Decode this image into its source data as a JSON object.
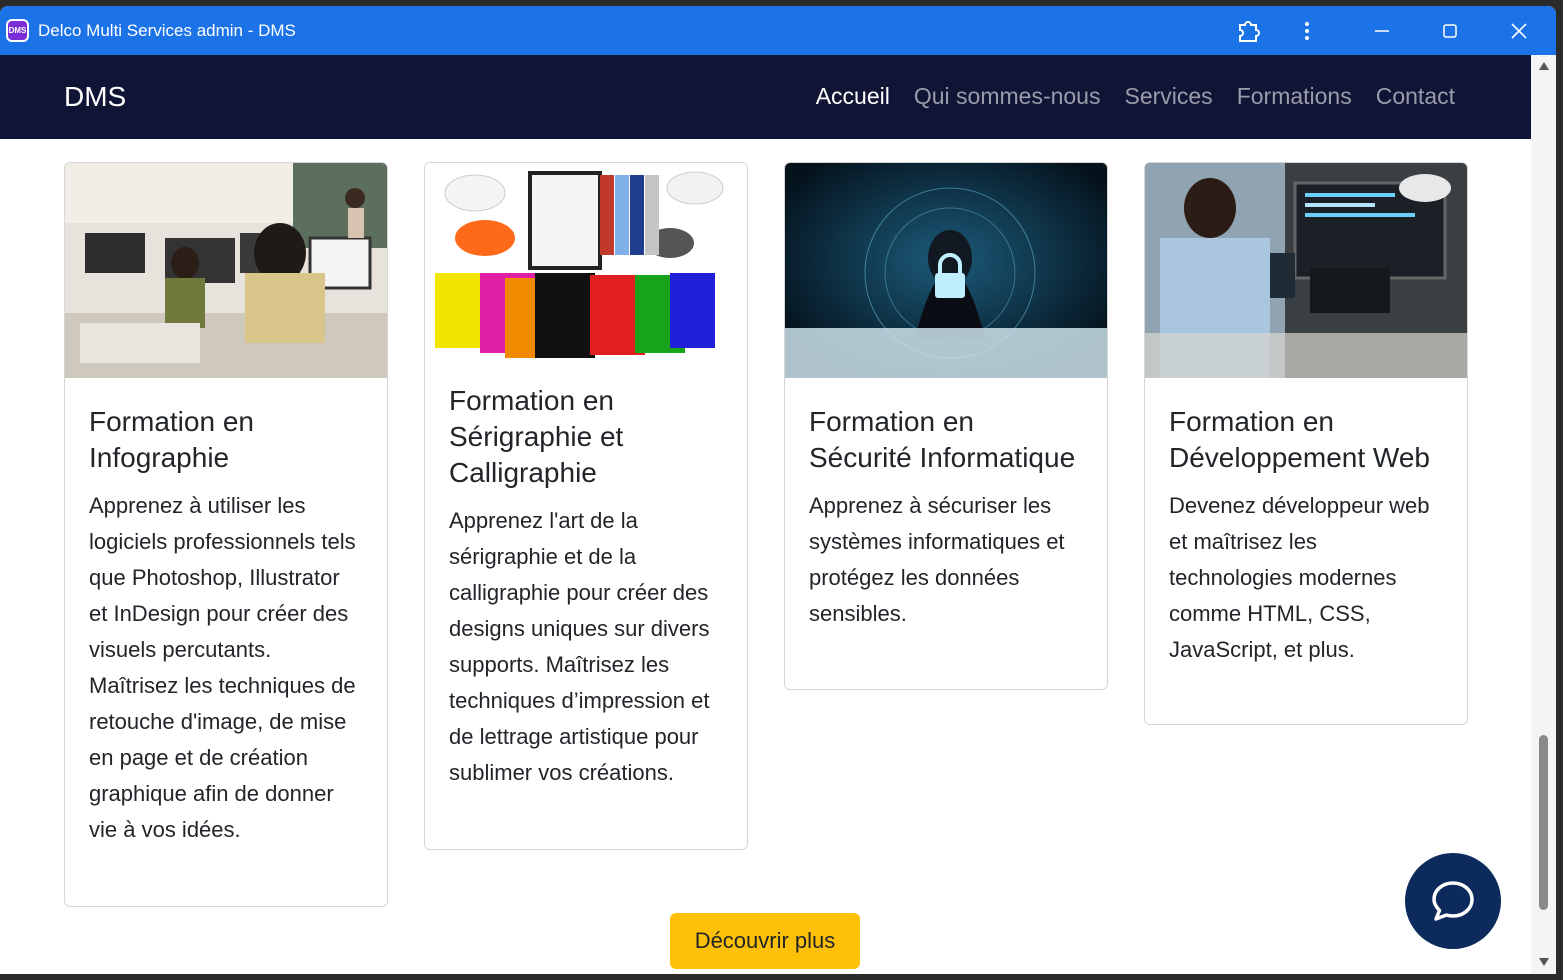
{
  "window": {
    "title": "Delco Multi Services admin - DMS",
    "app_icon_text": "DMS"
  },
  "navbar": {
    "brand": "DMS",
    "links": [
      {
        "label": "Accueil",
        "active": true
      },
      {
        "label": "Qui sommes-nous",
        "active": false
      },
      {
        "label": "Services",
        "active": false
      },
      {
        "label": "Formations",
        "active": false
      },
      {
        "label": "Contact",
        "active": false
      }
    ]
  },
  "cards": [
    {
      "title": "Formation en Infographie",
      "text": "Apprenez à utiliser les logiciels professionnels tels que Photoshop, Illustrator et InDesign pour créer des visuels percutants. Maîtrisez les techniques de retouche d'image, de mise en page et de création graphique afin de donner vie à vos idées.",
      "image": "classroom-computers-photo"
    },
    {
      "title": "Formation en Sérigraphie et Calligraphie",
      "text": "Apprenez l'art de la sérigraphie et de la calligraphie pour créer des designs uniques sur divers supports. Maîtrisez les techniques d’impression et de lettrage artistique pour sublimer vos créations.",
      "image": "tshirts-caps-photo"
    },
    {
      "title": "Formation en Sécurité Informatique",
      "text": "Apprenez à sécuriser les systèmes informatiques et protégez les données sensibles.",
      "image": "hacker-padlock-photo"
    },
    {
      "title": "Formation en Développement Web",
      "text": "Devenez développeur web et maîtrisez les technologies modernes comme HTML, CSS, JavaScript, et plus.",
      "image": "developer-coding-photo"
    }
  ],
  "cta": {
    "label": "Découvrir plus"
  },
  "colors": {
    "titlebar": "#1c73e8",
    "navbar": "#111535",
    "cta": "#ffc107",
    "chat": "#0d2a5c"
  },
  "icons": {
    "chat": "chat-bubble-icon",
    "extensions": "puzzle-icon",
    "menu": "kebab-menu-icon",
    "minimize": "minimize-icon",
    "maximize": "maximize-icon",
    "close": "close-icon"
  }
}
